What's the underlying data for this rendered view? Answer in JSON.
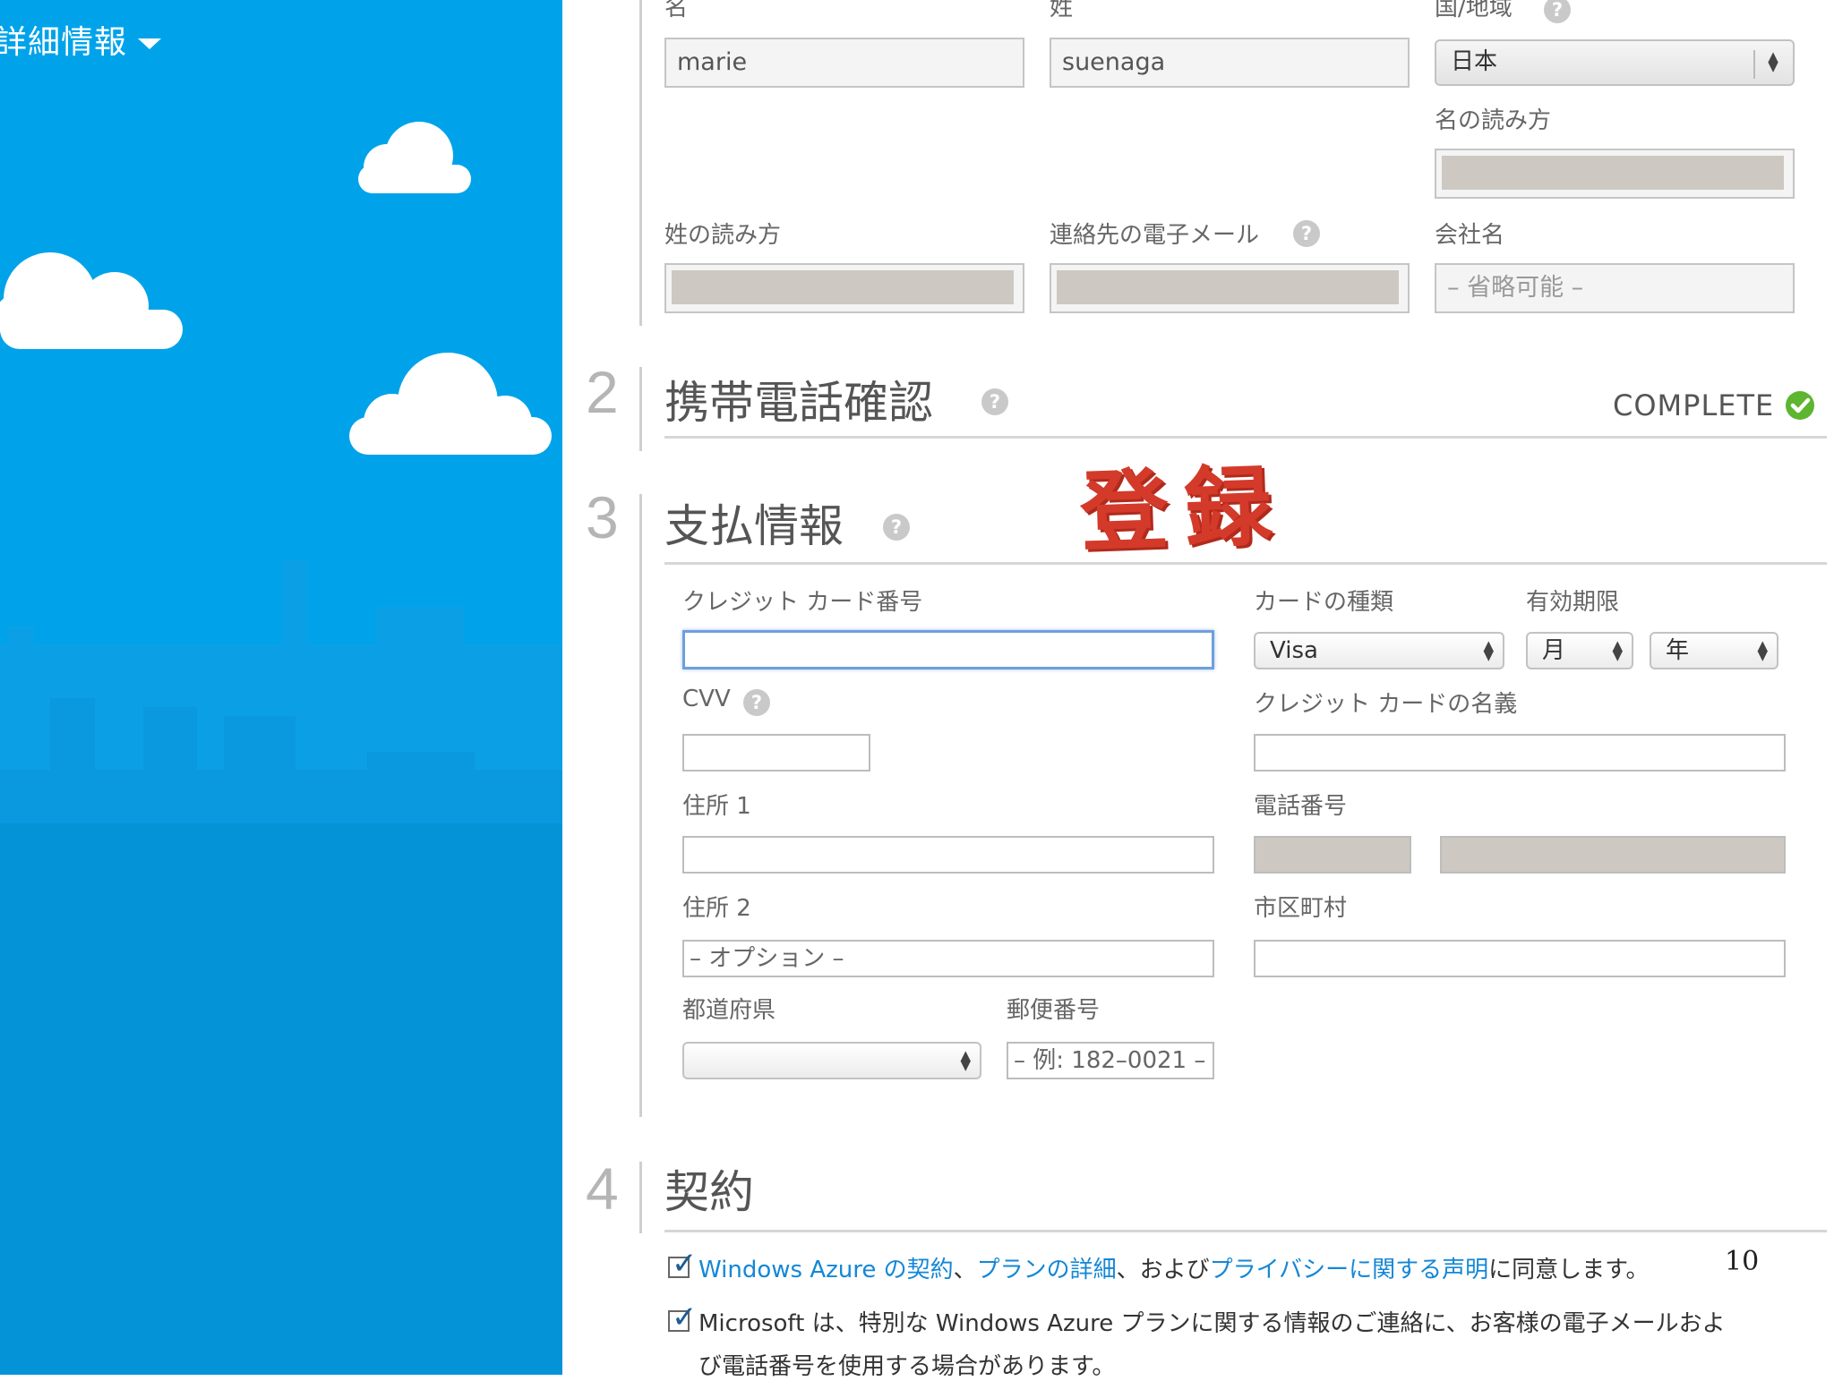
{
  "sidebar": {
    "title": "詳細情報"
  },
  "section1": {
    "first_name": {
      "label": "名",
      "value": "marie"
    },
    "last_name": {
      "label": "姓",
      "value": "suenaga"
    },
    "country": {
      "label": "国/地域",
      "value": "日本"
    },
    "first_reading": {
      "label": "名の読み方"
    },
    "last_reading": {
      "label": "姓の読み方"
    },
    "email": {
      "label": "連絡先の電子メール"
    },
    "company": {
      "label": "会社名",
      "placeholder": "– 省略可能 –"
    }
  },
  "section2": {
    "number": "2",
    "title": "携帯電話確認",
    "status": "COMPLETE"
  },
  "section3": {
    "number": "3",
    "title": "支払情報",
    "card_number": {
      "label": "クレジット カード番号",
      "value": ""
    },
    "card_type": {
      "label": "カードの種類",
      "value": "Visa"
    },
    "expiry": {
      "label": "有効期限",
      "month": "月",
      "year": "年"
    },
    "cvv": {
      "label": "CVV"
    },
    "card_name": {
      "label": "クレジット カードの名義"
    },
    "address1": {
      "label": "住所 1"
    },
    "phone": {
      "label": "電話番号"
    },
    "address2": {
      "label": "住所 2",
      "placeholder": "– オプション –"
    },
    "city": {
      "label": "市区町村"
    },
    "prefecture": {
      "label": "都道府県",
      "value": ""
    },
    "postal": {
      "label": "郵便番号",
      "placeholder": "– 例: 182–0021 –"
    }
  },
  "stamp": "登録",
  "section4": {
    "number": "4",
    "title": "契約",
    "agree1": {
      "link1": "Windows Azure の契約",
      "sep1": "、",
      "link2": "プランの詳細",
      "sep2": "、および",
      "link3": "プライバシーに関する声明",
      "tail": "に同意します。",
      "checked": true
    },
    "agree2": {
      "line1": "Microsoft は、特別な Windows Azure プランに関する情報のご連絡に、お客様の電子メールおよ",
      "line2": "び電話番号を使用する場合があります。",
      "checked": true
    }
  },
  "page_number": "10",
  "colors": {
    "sky": "#00a3ea",
    "skyline_dark": "#0090d6",
    "accent_link": "#1487d6",
    "complete": "#5db530",
    "stamp": "#d43a2a"
  }
}
